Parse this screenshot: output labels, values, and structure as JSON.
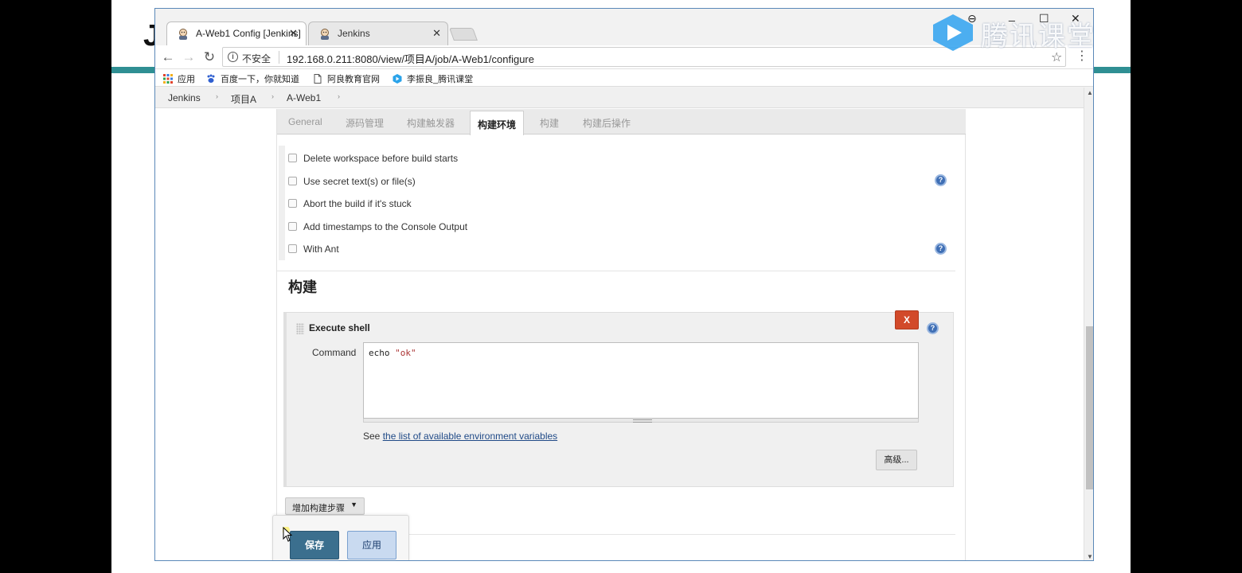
{
  "slide": {
    "letter": "J"
  },
  "watermark": {
    "text": "腾讯课堂"
  },
  "browser": {
    "tabs": [
      {
        "title": "A-Web1 Config [Jenkins]",
        "close": "✕"
      },
      {
        "title": "Jenkins",
        "close": "✕"
      }
    ],
    "window_controls": {
      "profile": "⊖",
      "minimize": "_",
      "maximize": "☐",
      "close": "✕"
    },
    "toolbar": {
      "back": "←",
      "forward": "→",
      "reload": "↻",
      "security": "不安全",
      "url": "192.168.0.211:8080/view/项目A/job/A-Web1/configure",
      "star": "☆",
      "menu": "⋮"
    },
    "bookmarks": [
      {
        "label": "应用",
        "icon": "apps-grid-icon"
      },
      {
        "label": "百度一下，你就知道",
        "icon": "baidu-paw-icon"
      },
      {
        "label": "阿良教育官网",
        "icon": "page-icon"
      },
      {
        "label": "李振良_腾讯课堂",
        "icon": "tencent-classroom-icon"
      }
    ]
  },
  "breadcrumbs": [
    "Jenkins",
    "项目A",
    "A-Web1"
  ],
  "config_tabs": {
    "items": [
      "General",
      "源码管理",
      "构建触发器",
      "构建环境",
      "构建",
      "构建后操作"
    ],
    "active": "构建环境"
  },
  "build_env_options": [
    {
      "label": "Delete workspace before build starts",
      "checked": false,
      "help": false
    },
    {
      "label": "Use secret text(s) or file(s)",
      "checked": false,
      "help": true
    },
    {
      "label": "Abort the build if it's stuck",
      "checked": false,
      "help": false
    },
    {
      "label": "Add timestamps to the Console Output",
      "checked": false,
      "help": false
    },
    {
      "label": "With Ant",
      "checked": false,
      "help": true
    }
  ],
  "build_section": {
    "heading": "构建",
    "step": {
      "title": "Execute shell",
      "delete_label": "X",
      "command_label": "Command",
      "command_keyword": "echo",
      "command_string": "\"ok\"",
      "see_text": "See",
      "env_link": "the list of available environment variables",
      "advanced_label": "高级..."
    },
    "add_step_label": "增加构建步骤",
    "add_step_caret": "▼"
  },
  "actions": {
    "save_label": "保存",
    "apply_label": "应用"
  },
  "colors": {
    "accent_bar": "#2f8f93",
    "save_button": "#3b6f8e",
    "apply_button": "#c9daf0",
    "delete_button": "#d24a2a",
    "help_icon": "#3f6fb5"
  }
}
